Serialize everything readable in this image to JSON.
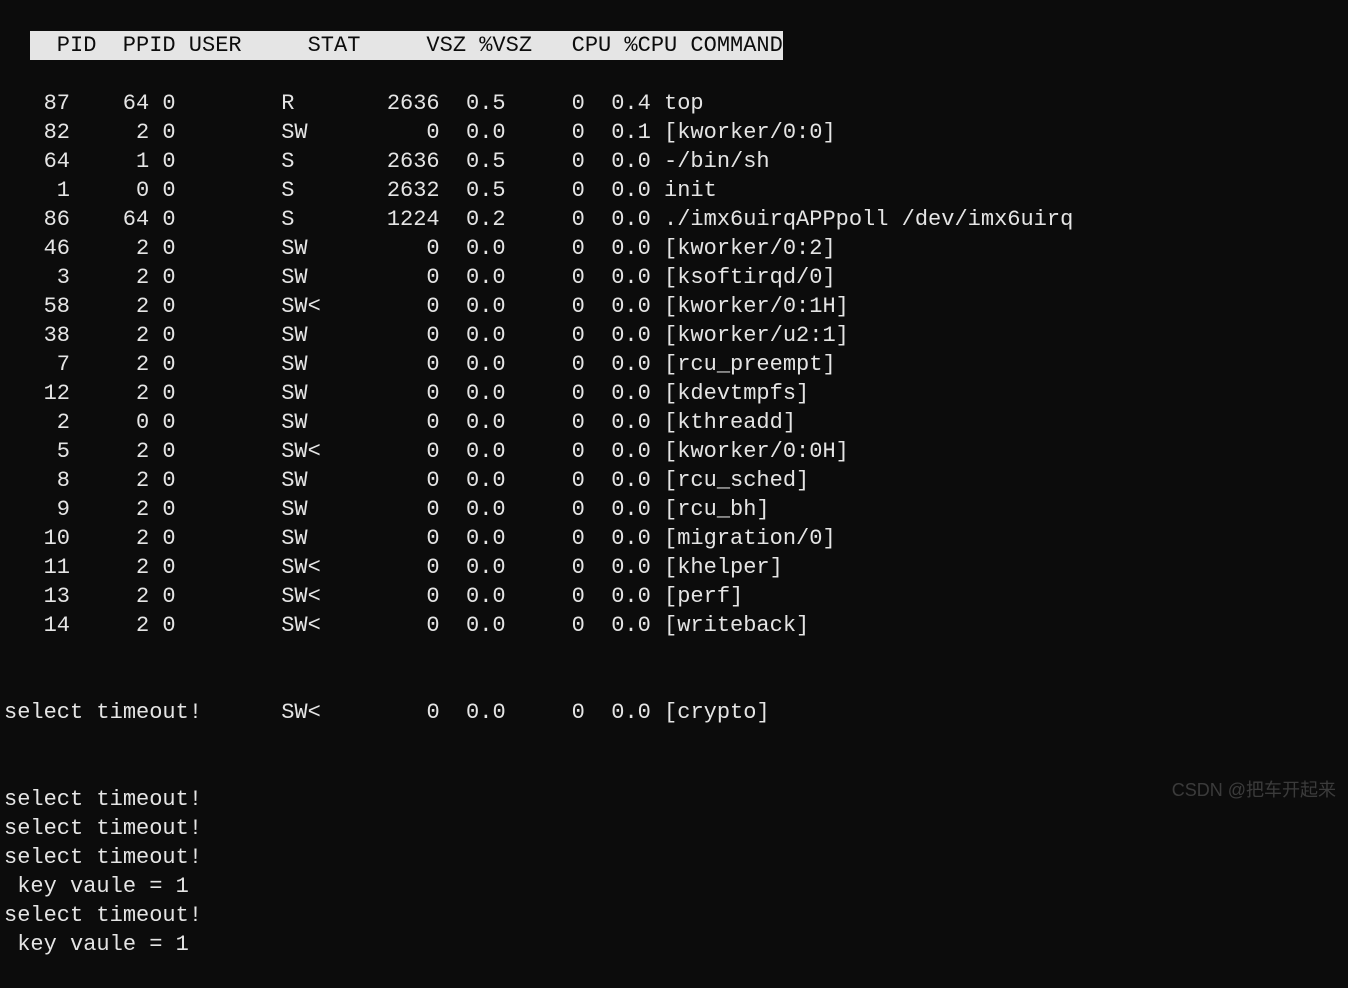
{
  "header": {
    "pid": "  PID",
    "ppid": "  PPID",
    "user": "USER",
    "stat": "STAT",
    "vsz": "VSZ",
    "vszp": " %VSZ",
    "cpu": "CPU",
    "cpup": " %CPU",
    "cmd": "COMMAND"
  },
  "rows": [
    {
      "pid": "87",
      "ppid": "64",
      "user": "0",
      "stat": "R",
      "vsz": "2636",
      "vszp": "0.5",
      "cpu": "0",
      "cpup": "0.4",
      "cmd": "top"
    },
    {
      "pid": "82",
      "ppid": "2",
      "user": "0",
      "stat": "SW",
      "vsz": "0",
      "vszp": "0.0",
      "cpu": "0",
      "cpup": "0.1",
      "cmd": "[kworker/0:0]"
    },
    {
      "pid": "64",
      "ppid": "1",
      "user": "0",
      "stat": "S",
      "vsz": "2636",
      "vszp": "0.5",
      "cpu": "0",
      "cpup": "0.0",
      "cmd": "-/bin/sh"
    },
    {
      "pid": "1",
      "ppid": "0",
      "user": "0",
      "stat": "S",
      "vsz": "2632",
      "vszp": "0.5",
      "cpu": "0",
      "cpup": "0.0",
      "cmd": "init"
    },
    {
      "pid": "86",
      "ppid": "64",
      "user": "0",
      "stat": "S",
      "vsz": "1224",
      "vszp": "0.2",
      "cpu": "0",
      "cpup": "0.0",
      "cmd": "./imx6uirqAPPpoll /dev/imx6uirq"
    },
    {
      "pid": "46",
      "ppid": "2",
      "user": "0",
      "stat": "SW",
      "vsz": "0",
      "vszp": "0.0",
      "cpu": "0",
      "cpup": "0.0",
      "cmd": "[kworker/0:2]"
    },
    {
      "pid": "3",
      "ppid": "2",
      "user": "0",
      "stat": "SW",
      "vsz": "0",
      "vszp": "0.0",
      "cpu": "0",
      "cpup": "0.0",
      "cmd": "[ksoftirqd/0]"
    },
    {
      "pid": "58",
      "ppid": "2",
      "user": "0",
      "stat": "SW<",
      "vsz": "0",
      "vszp": "0.0",
      "cpu": "0",
      "cpup": "0.0",
      "cmd": "[kworker/0:1H]"
    },
    {
      "pid": "38",
      "ppid": "2",
      "user": "0",
      "stat": "SW",
      "vsz": "0",
      "vszp": "0.0",
      "cpu": "0",
      "cpup": "0.0",
      "cmd": "[kworker/u2:1]"
    },
    {
      "pid": "7",
      "ppid": "2",
      "user": "0",
      "stat": "SW",
      "vsz": "0",
      "vszp": "0.0",
      "cpu": "0",
      "cpup": "0.0",
      "cmd": "[rcu_preempt]"
    },
    {
      "pid": "12",
      "ppid": "2",
      "user": "0",
      "stat": "SW",
      "vsz": "0",
      "vszp": "0.0",
      "cpu": "0",
      "cpup": "0.0",
      "cmd": "[kdevtmpfs]"
    },
    {
      "pid": "2",
      "ppid": "0",
      "user": "0",
      "stat": "SW",
      "vsz": "0",
      "vszp": "0.0",
      "cpu": "0",
      "cpup": "0.0",
      "cmd": "[kthreadd]"
    },
    {
      "pid": "5",
      "ppid": "2",
      "user": "0",
      "stat": "SW<",
      "vsz": "0",
      "vszp": "0.0",
      "cpu": "0",
      "cpup": "0.0",
      "cmd": "[kworker/0:0H]"
    },
    {
      "pid": "8",
      "ppid": "2",
      "user": "0",
      "stat": "SW",
      "vsz": "0",
      "vszp": "0.0",
      "cpu": "0",
      "cpup": "0.0",
      "cmd": "[rcu_sched]"
    },
    {
      "pid": "9",
      "ppid": "2",
      "user": "0",
      "stat": "SW",
      "vsz": "0",
      "vszp": "0.0",
      "cpu": "0",
      "cpup": "0.0",
      "cmd": "[rcu_bh]"
    },
    {
      "pid": "10",
      "ppid": "2",
      "user": "0",
      "stat": "SW",
      "vsz": "0",
      "vszp": "0.0",
      "cpu": "0",
      "cpup": "0.0",
      "cmd": "[migration/0]"
    },
    {
      "pid": "11",
      "ppid": "2",
      "user": "0",
      "stat": "SW<",
      "vsz": "0",
      "vszp": "0.0",
      "cpu": "0",
      "cpup": "0.0",
      "cmd": "[khelper]"
    },
    {
      "pid": "13",
      "ppid": "2",
      "user": "0",
      "stat": "SW<",
      "vsz": "0",
      "vszp": "0.0",
      "cpu": "0",
      "cpup": "0.0",
      "cmd": "[perf]"
    },
    {
      "pid": "14",
      "ppid": "2",
      "user": "0",
      "stat": "SW<",
      "vsz": "0",
      "vszp": "0.0",
      "cpu": "0",
      "cpup": "0.0",
      "cmd": "[writeback]"
    }
  ],
  "overlap_row": {
    "indent": "select timeout!",
    "stat": "SW<",
    "vsz": "0",
    "vszp": "0.0",
    "cpu": "0",
    "cpup": "0.0",
    "cmd": "[crypto]"
  },
  "messages": [
    "select timeout!",
    "select timeout!",
    "select timeout!",
    " key vaule = 1",
    "select timeout!",
    " key vaule = 1"
  ],
  "watermark": "CSDN @把车开起来"
}
